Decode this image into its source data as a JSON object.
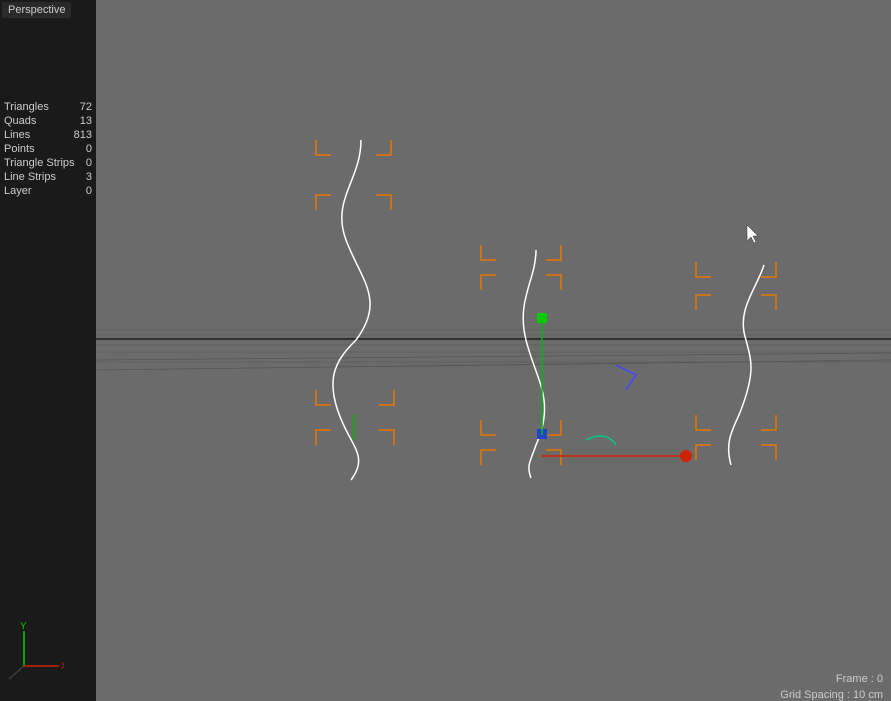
{
  "viewport": {
    "label": "Perspective",
    "background_color": "#6b6b6b"
  },
  "stats": {
    "triangles_label": "Triangles",
    "triangles_value": "72",
    "quads_label": "Quads",
    "quads_value": "13",
    "lines_label": "Lines",
    "lines_value": "813",
    "points_label": "Points",
    "points_value": "0",
    "triangle_strips_label": "Triangle Strips",
    "triangle_strips_value": "0",
    "line_strips_label": "Line Strips",
    "line_strips_value": "3",
    "layer_label": "Layer",
    "layer_value": "0"
  },
  "bottom": {
    "frame_label": "Frame : 0",
    "grid_spacing_label": "Grid Spacing : 10 cm"
  }
}
